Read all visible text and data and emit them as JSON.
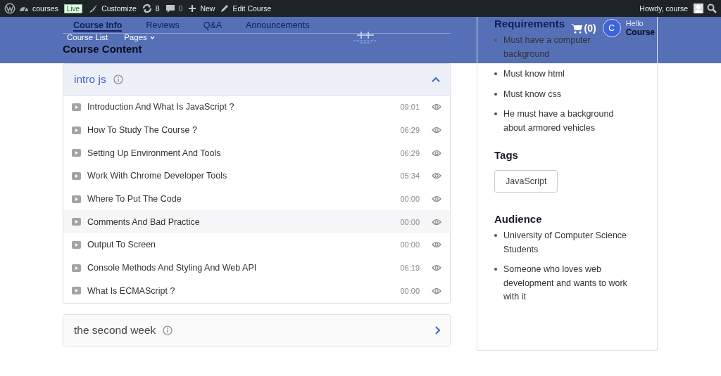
{
  "admin_bar": {
    "site": "courses",
    "live_badge": "Live",
    "customize": "Customize",
    "updates": "8",
    "comments": "0",
    "new": "New",
    "edit": "Edit Course",
    "greeting": "Howdy, course"
  },
  "header": {
    "nav": [
      {
        "label": "Course List",
        "kind": "link"
      },
      {
        "label": "Pages",
        "kind": "dropdown"
      }
    ],
    "cart": "(0)",
    "avatar": "C",
    "hello": "Hello",
    "user": "Course"
  },
  "tabs": [
    {
      "label": "Course Info",
      "selected": true
    },
    {
      "label": "Reviews",
      "selected": false
    },
    {
      "label": "Q&A",
      "selected": false
    },
    {
      "label": "Announcements",
      "selected": false
    }
  ],
  "content_title": "Course Content",
  "topics": [
    {
      "title": "intro js",
      "expanded": true,
      "lessons": [
        {
          "title": "Introduction And What Is JavaScript ?",
          "duration": "09:01",
          "highlighted": false
        },
        {
          "title": "How To Study The Course ?",
          "duration": "06:29",
          "highlighted": false
        },
        {
          "title": "Setting Up Environment And Tools",
          "duration": "06:29",
          "highlighted": false
        },
        {
          "title": "Work With Chrome Developer Tools",
          "duration": "05:34",
          "highlighted": false
        },
        {
          "title": "Where To Put The Code",
          "duration": "00:00",
          "highlighted": false
        },
        {
          "title": "Comments And Bad Practice",
          "duration": "00:00",
          "highlighted": true
        },
        {
          "title": "Output To Screen",
          "duration": "00:00",
          "highlighted": false
        },
        {
          "title": "Console Methods And Styling And Web API",
          "duration": "06:19",
          "highlighted": false
        },
        {
          "title": "What Is ECMAScript ?",
          "duration": "00:00",
          "highlighted": false
        }
      ]
    },
    {
      "title": "the second week",
      "expanded": false
    }
  ],
  "sidebar": {
    "requirements": {
      "title": "Requirements",
      "items": [
        "Must have a computer background",
        "Must know html",
        "Must know css",
        "He must have a background about armored vehicles"
      ]
    },
    "tags": {
      "title": "Tags",
      "items": [
        "JavaScript"
      ]
    },
    "audience": {
      "title": "Audience",
      "items": [
        "University of Computer Science Students",
        "Someone who loves web development and wants to work with it"
      ]
    }
  }
}
